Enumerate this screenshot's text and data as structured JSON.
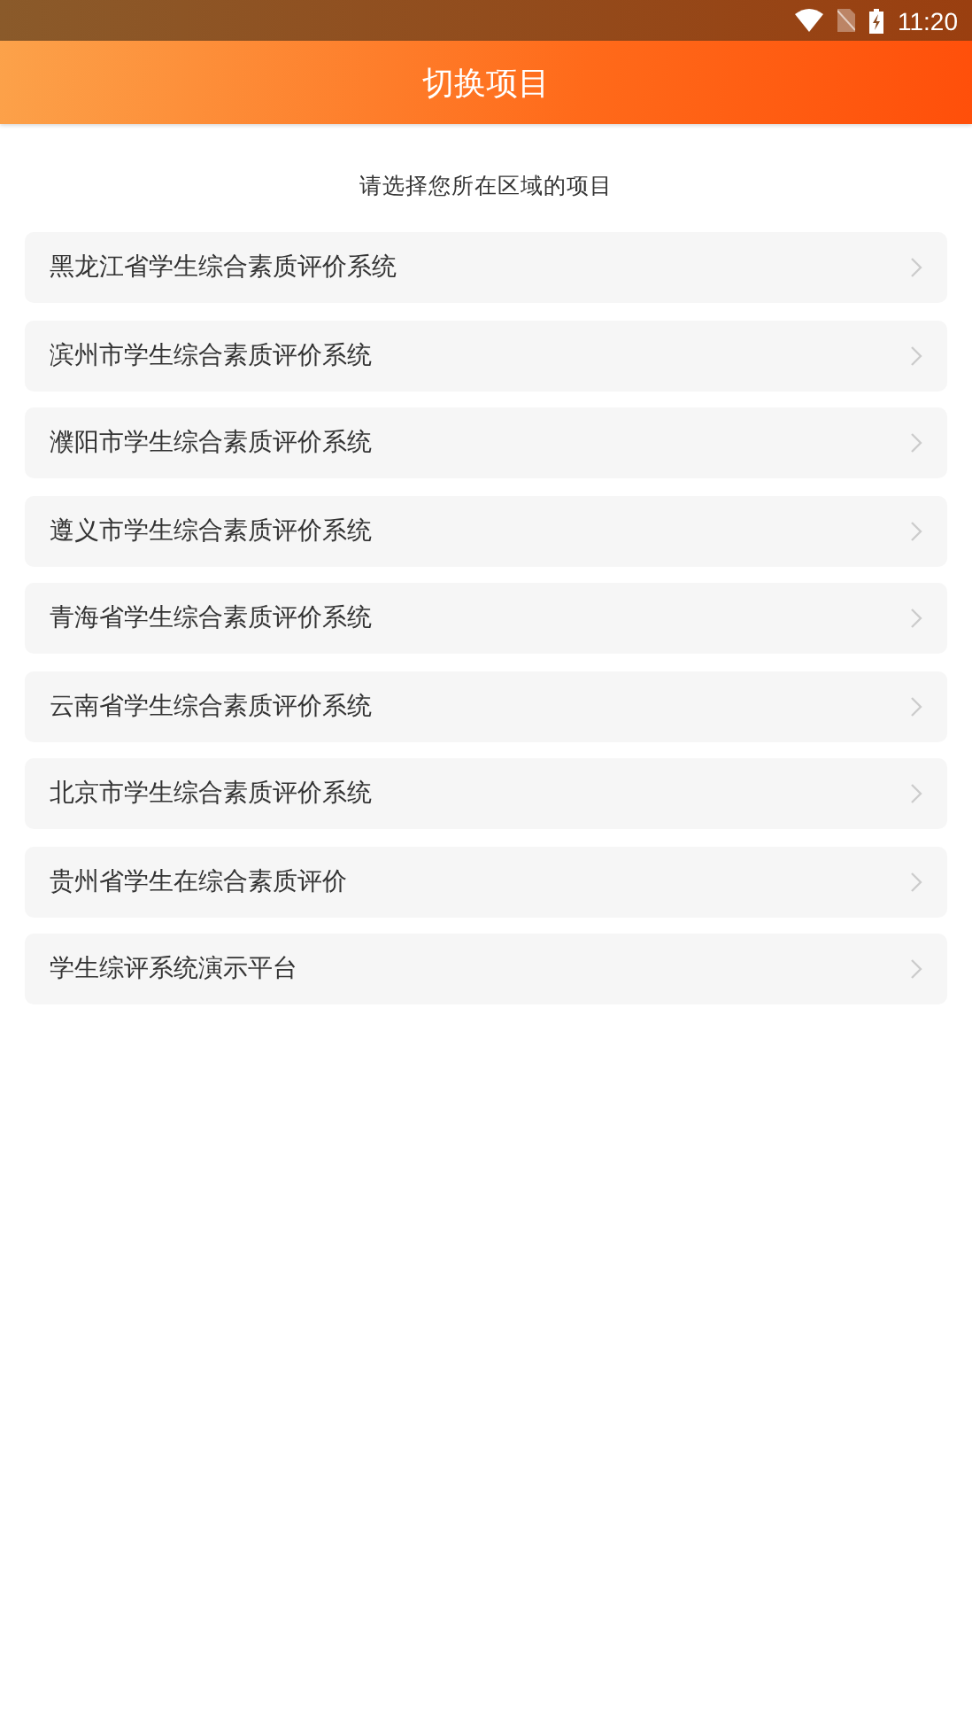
{
  "status_bar": {
    "time": "11:20"
  },
  "header": {
    "title": "切换项目"
  },
  "prompt": "请选择您所在区域的项目",
  "projects": [
    {
      "name": "黑龙江省学生综合素质评价系统"
    },
    {
      "name": "滨州市学生综合素质评价系统"
    },
    {
      "name": "濮阳市学生综合素质评价系统"
    },
    {
      "name": "遵义市学生综合素质评价系统"
    },
    {
      "name": "青海省学生综合素质评价系统"
    },
    {
      "name": "云南省学生综合素质评价系统"
    },
    {
      "name": "北京市学生综合素质评价系统"
    },
    {
      "name": "贵州省学生在综合素质评价"
    },
    {
      "name": "学生综评系统演示平台"
    }
  ]
}
